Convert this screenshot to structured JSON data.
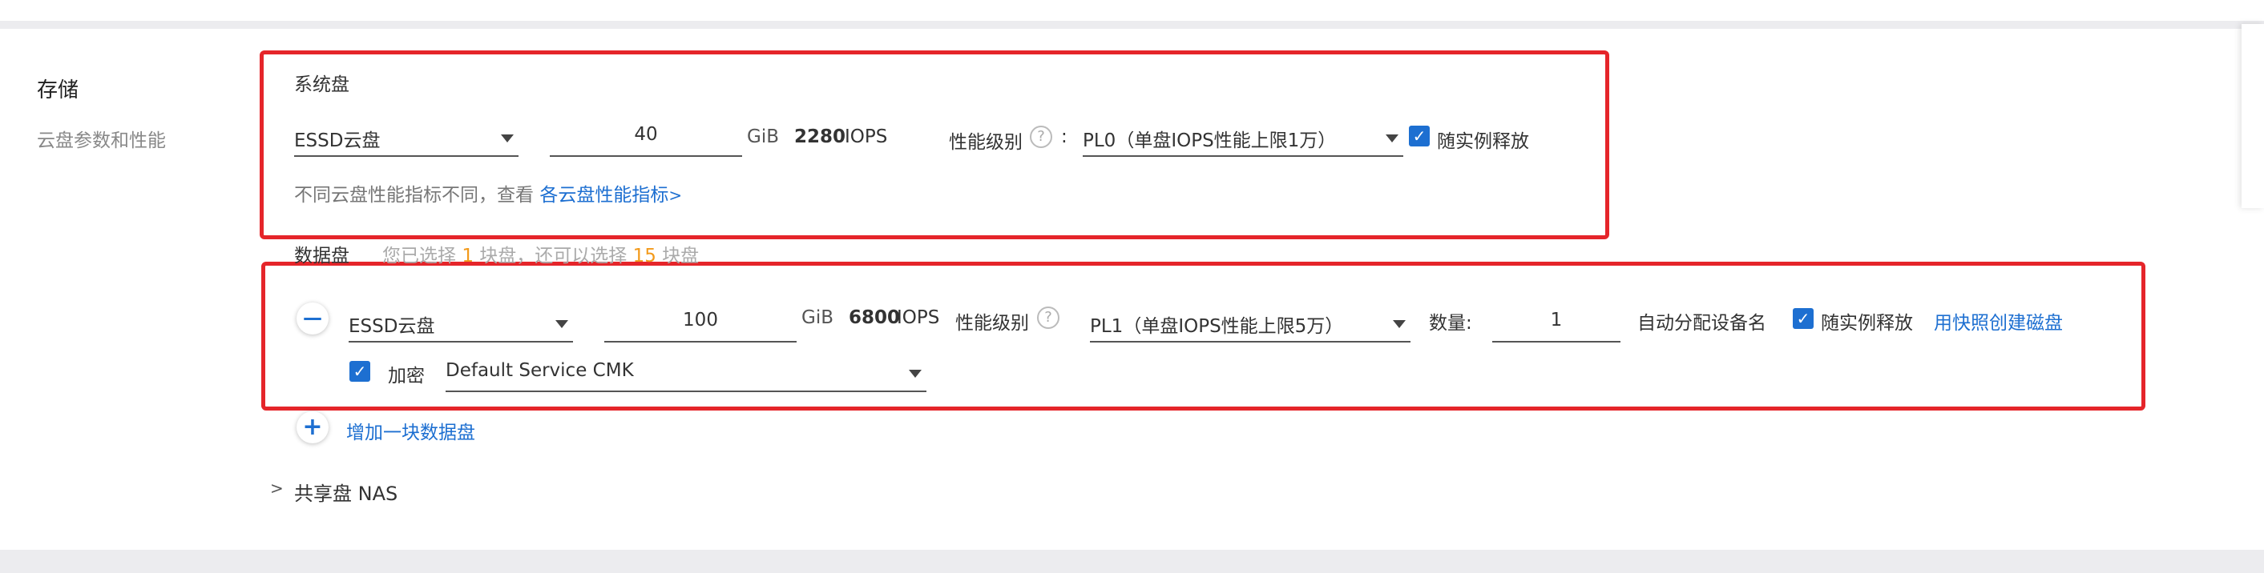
{
  "storage": {
    "title": "存储",
    "subtitle": "云盘参数和性能"
  },
  "system_disk": {
    "heading": "系统盘",
    "type": "ESSD云盘",
    "size": "40",
    "unit": "GiB",
    "iops_value": "2280",
    "iops_label": "IOPS",
    "perf_label": "性能级别",
    "colon": ":",
    "perf_level": "PL0（单盘IOPS性能上限1万）",
    "release_label": "随实例释放",
    "note": "不同云盘性能指标不同，查看",
    "note_link": "各云盘性能指标",
    "note_link_arrow": ">"
  },
  "data_disk_header": {
    "heading": "数据盘",
    "hint_prefix": "您已选择",
    "selected_count": "1",
    "hint_mid": "块盘，还可以选择",
    "remaining_count": "15",
    "hint_suffix": "块盘"
  },
  "data_disk": {
    "type": "ESSD云盘",
    "size": "100",
    "unit": "GiB",
    "iops_value": "6800",
    "iops_label": "IOPS",
    "perf_label": "性能级别",
    "perf_level": "PL1（单盘IOPS性能上限5万）",
    "qty_label": "数量:",
    "qty_value": "1",
    "auto_device_label": "自动分配设备名",
    "release_label": "随实例释放",
    "snapshot_link": "用快照创建磁盘",
    "encrypt_label": "加密",
    "encrypt_key": "Default Service CMK"
  },
  "add_disk": {
    "label": "增加一块数据盘",
    "icon": "+"
  },
  "remove_disk": {
    "icon": "—"
  },
  "nas": {
    "label": "共享盘 NAS",
    "chevron": ">"
  },
  "icons": {
    "help": "?",
    "check": "✓"
  },
  "colors": {
    "accent": "#1d6fd1",
    "highlight_box": "#e5252a",
    "count_highlight": "#f39a1b"
  }
}
